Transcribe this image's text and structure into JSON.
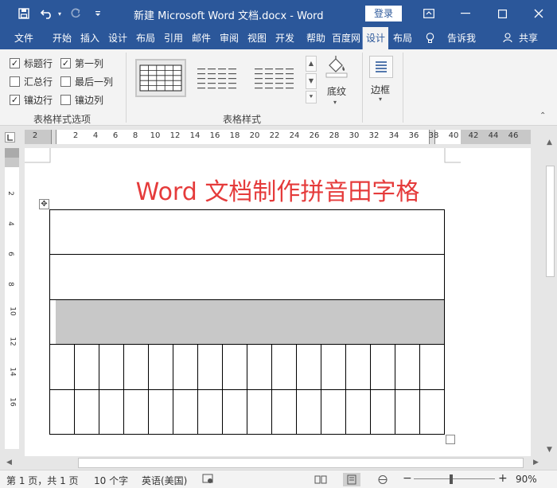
{
  "window": {
    "title": "新建 Microsoft Word 文档.docx  -  Word",
    "login_label": "登录"
  },
  "tabs": [
    {
      "label": "文件"
    },
    {
      "label": "开始"
    },
    {
      "label": "插入"
    },
    {
      "label": "设计"
    },
    {
      "label": "布局"
    },
    {
      "label": "引用"
    },
    {
      "label": "邮件"
    },
    {
      "label": "审阅"
    },
    {
      "label": "视图"
    },
    {
      "label": "开发"
    },
    {
      "label": "帮助"
    },
    {
      "label": "百度网"
    },
    {
      "label": "设计",
      "active": true
    },
    {
      "label": "布局"
    }
  ],
  "tell_me": "告诉我",
  "share": "共享",
  "ribbon": {
    "options": [
      {
        "label": "标题行",
        "checked": true
      },
      {
        "label": "第一列",
        "checked": true
      },
      {
        "label": "汇总行",
        "checked": false
      },
      {
        "label": "最后一列",
        "checked": false
      },
      {
        "label": "镶边行",
        "checked": true
      },
      {
        "label": "镶边列",
        "checked": false
      }
    ],
    "options_group_label": "表格样式选项",
    "styles_group_label": "表格样式",
    "shading_label": "底纹",
    "borders_label": "边框"
  },
  "ruler": {
    "h_labels": [
      "2",
      "2",
      "4",
      "6",
      "8",
      "10",
      "12",
      "14",
      "16",
      "18",
      "20",
      "22",
      "24",
      "26",
      "28",
      "30",
      "32",
      "34",
      "36",
      "38",
      "40",
      "42",
      "44",
      "46"
    ],
    "v_labels": [
      "2",
      "4",
      "6",
      "8",
      "10",
      "12",
      "14",
      "16"
    ]
  },
  "document": {
    "heading": "Word 文档制作拼音田字格",
    "heading_color": "#e53b3b",
    "shaded_row_color": "#c8c8c8"
  },
  "status": {
    "page": "第 1 页，共 1 页",
    "words": "10 个字",
    "language": "英语(美国)",
    "zoom": "90%"
  },
  "colors": {
    "accent": "#2b579a",
    "ribbon_bg": "#f3f3f3"
  }
}
